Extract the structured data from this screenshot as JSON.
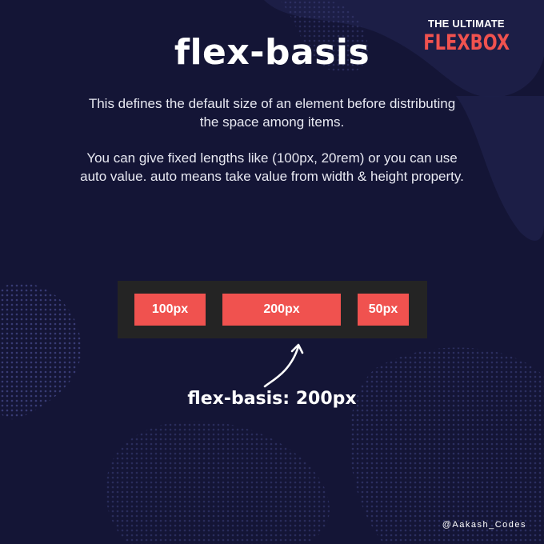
{
  "brand": {
    "top": "THE ULTIMATE",
    "main": "FLEXBOX",
    "accent_color": "#f0524f"
  },
  "title": "flex-basis",
  "description": [
    "This defines the default size of an element before distributing the space among items.",
    "You can give fixed lengths like (100px, 20rem) or you can use auto value. auto means take value from width & height property."
  ],
  "demo": {
    "items": [
      {
        "label": "100px"
      },
      {
        "label": "200px"
      },
      {
        "label": "50px"
      }
    ],
    "container_color": "#242424",
    "item_color": "#f0524f"
  },
  "caption": "flex-basis: 200px",
  "handle": "@Aakash_Codes",
  "icons": {
    "arrow": "curved-arrow-up-icon"
  },
  "background_color": "#141536"
}
